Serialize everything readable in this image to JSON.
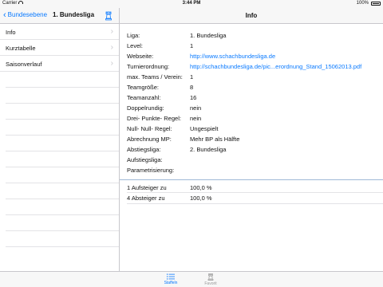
{
  "status": {
    "carrier": "Carrier",
    "time": "3:44 PM",
    "battery": "100%"
  },
  "nav": {
    "back_label": "Bundesebene",
    "left_title": "1. Bundesliga",
    "right_title": "Info"
  },
  "sidebar": {
    "items": [
      {
        "label": "Info"
      },
      {
        "label": "Kurztabelle"
      },
      {
        "label": "Saisonverlauf"
      }
    ]
  },
  "info": {
    "rows": [
      {
        "label": "Liga:",
        "value": "1. Bundesliga"
      },
      {
        "label": "Level:",
        "value": "1"
      },
      {
        "label": "Webseite:",
        "value": "http://www.schachbundesliga.de"
      },
      {
        "label": "Turnierordnung:",
        "value": "http://schachbundesliga.de/pic...erordnung_Stand_15062013.pdf"
      },
      {
        "label": "max. Teams / Verein:",
        "value": "1"
      },
      {
        "label": "Teamgröße:",
        "value": "8"
      },
      {
        "label": "Teamanzahl:",
        "value": "16"
      },
      {
        "label": "Doppelrundig:",
        "value": "nein"
      },
      {
        "label": "Drei- Punkte- Regel:",
        "value": "nein"
      },
      {
        "label": "Null- Null- Regel:",
        "value": "Ungespielt"
      },
      {
        "label": "Abrechnung MP:",
        "value": "Mehr BP als Hälfte"
      },
      {
        "label": "Abstiegsliga:",
        "value": "2. Bundesliga"
      },
      {
        "label": "Aufstiegsliga:",
        "value": ""
      },
      {
        "label": "Parametrisierung:",
        "value": ""
      }
    ],
    "promotion": {
      "label": "1 Aufsteiger zu",
      "value": "100,0 %"
    },
    "relegation": {
      "label": "4 Absteiger zu",
      "value": "100,0 %"
    }
  },
  "tabs": {
    "staffeln": "Staffeln",
    "favorit": "Favorit"
  },
  "colors": {
    "accent": "#0a7aff",
    "separator": "#c8c7cc"
  }
}
